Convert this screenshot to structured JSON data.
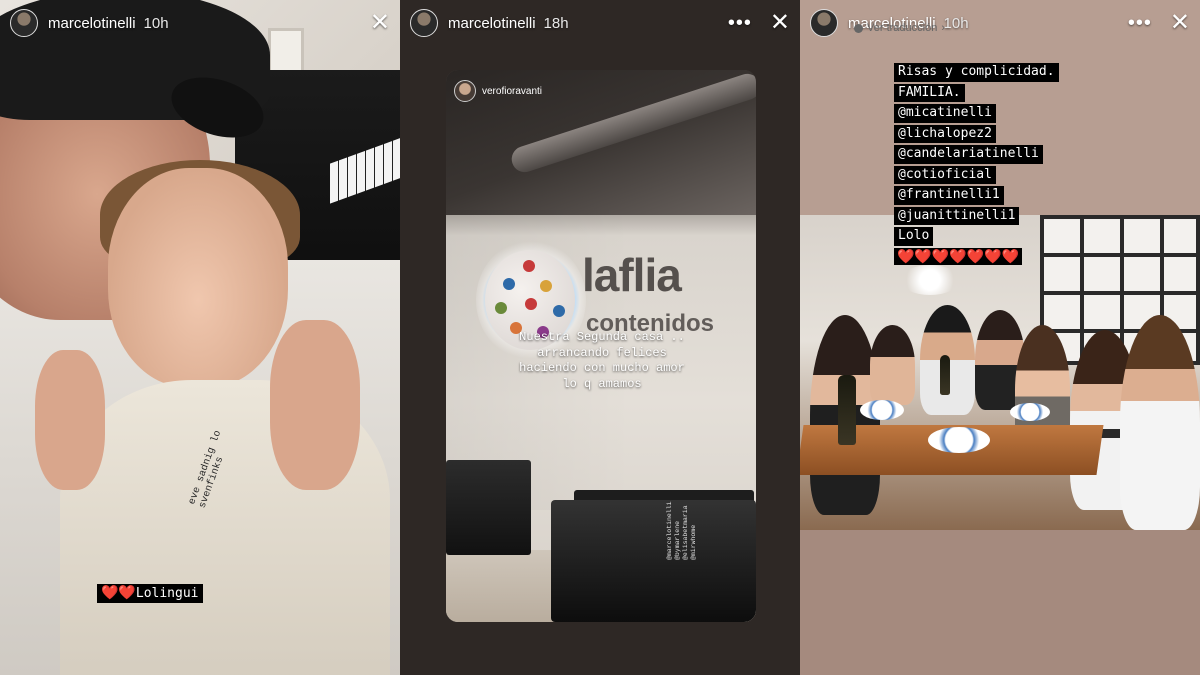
{
  "stories": [
    {
      "username": "marcelotinelli",
      "time": "10h",
      "menu_icon": "more-dots-icon",
      "close_icon": "close-icon",
      "caption_hearts": "❤️❤️",
      "caption_text": "Lolingui",
      "hoodie_print": "eve sadnig lo\nsvenfinks"
    },
    {
      "username": "marcelotinelli",
      "time": "18h",
      "menu_icon": "more-dots-icon",
      "close_icon": "close-icon",
      "reposted_from": "verofioravanti",
      "logo_text": "laflia",
      "logo_subtext": "contenidos",
      "caption_lines": [
        "Nuestra Segunda casa ..",
        "arrancando felices",
        "haciendo con mucho amor",
        "lo q amamos"
      ],
      "small_tags": [
        "@marcelotinelli",
        "@bymarlene",
        "@elisabetmaria",
        "@mirwhome"
      ]
    },
    {
      "username": "marcelotinelli",
      "time": "10h",
      "translate_label": "Ver traducción",
      "menu_icon": "more-dots-icon",
      "close_icon": "close-icon",
      "caption_lines": [
        "Risas y complicidad.",
        "FAMILIA.",
        "@micatinelli",
        "@lichalopez2",
        "@candelariatinelli",
        "@cotioficial",
        "@frantinelli1",
        "@juanittinelli1",
        "Lolo"
      ],
      "caption_hearts": "❤️❤️❤️❤️❤️❤️❤️"
    }
  ],
  "colors": {
    "sticker_bg": "#000000",
    "heart": "#e8232d",
    "panel3_top": "#b79e92"
  }
}
